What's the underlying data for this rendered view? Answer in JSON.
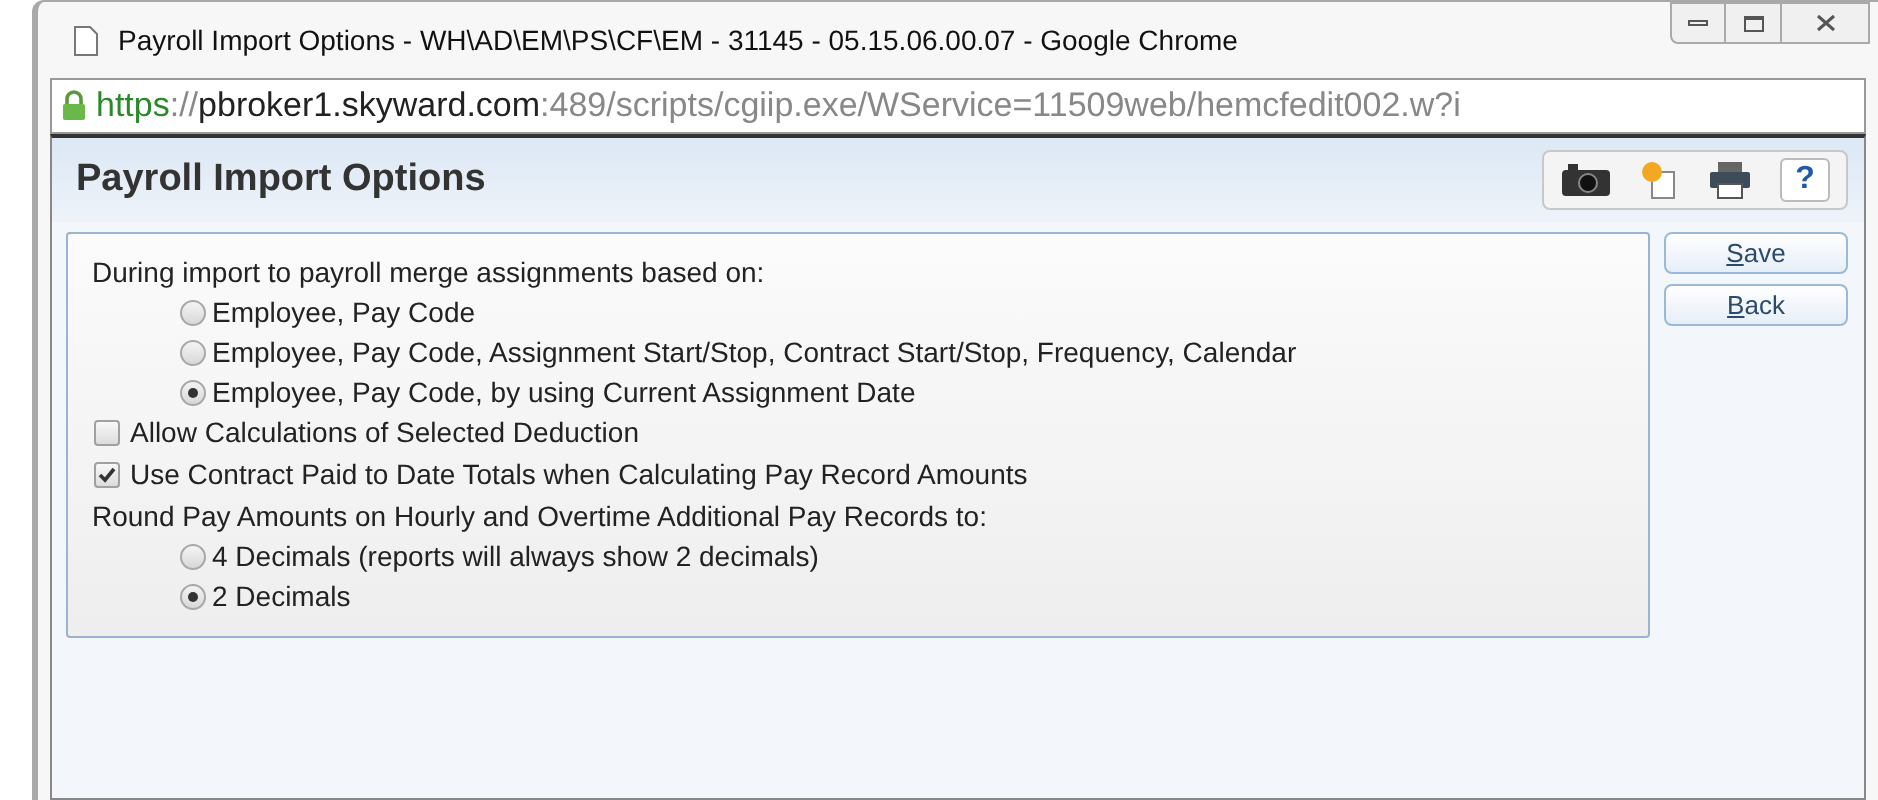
{
  "window": {
    "title": "Payroll Import Options - WH\\AD\\EM\\PS\\CF\\EM - 31145 - 05.15.06.00.07 - Google Chrome"
  },
  "address_bar": {
    "parts": [
      {
        "kind": "scheme",
        "text": "https"
      },
      {
        "kind": "rest",
        "text": "://"
      },
      {
        "kind": "host",
        "text": "pbroker1.skyward.com"
      },
      {
        "kind": "rest",
        "text": ":489/scripts/cgiip.exe/WService=11509web/hemcfedit002.w?i"
      }
    ]
  },
  "page": {
    "title": "Payroll Import Options",
    "rows": [
      {
        "kind": "text",
        "label": "During import to payroll merge assignments based on:"
      },
      {
        "kind": "radio",
        "label": "Employee, Pay Code",
        "selected": false
      },
      {
        "kind": "radio",
        "label": "Employee, Pay Code, Assignment Start/Stop, Contract Start/Stop, Frequency, Calendar",
        "selected": false
      },
      {
        "kind": "radio",
        "label": "Employee, Pay Code, by using Current Assignment Date",
        "selected": true
      },
      {
        "kind": "checkbox",
        "label": "Allow Calculations of Selected Deduction",
        "checked": false
      },
      {
        "kind": "checkbox",
        "label": "Use Contract Paid to Date Totals when Calculating Pay Record Amounts",
        "checked": true
      },
      {
        "kind": "text",
        "label": "Round Pay Amounts on Hourly and Overtime Additional Pay Records to:"
      },
      {
        "kind": "radio",
        "label": "4 Decimals (reports will always show 2 decimals)",
        "selected": false
      },
      {
        "kind": "radio",
        "label": "2 Decimals",
        "selected": true
      }
    ],
    "help_label": "?",
    "buttons": [
      "Save",
      "Back"
    ]
  }
}
